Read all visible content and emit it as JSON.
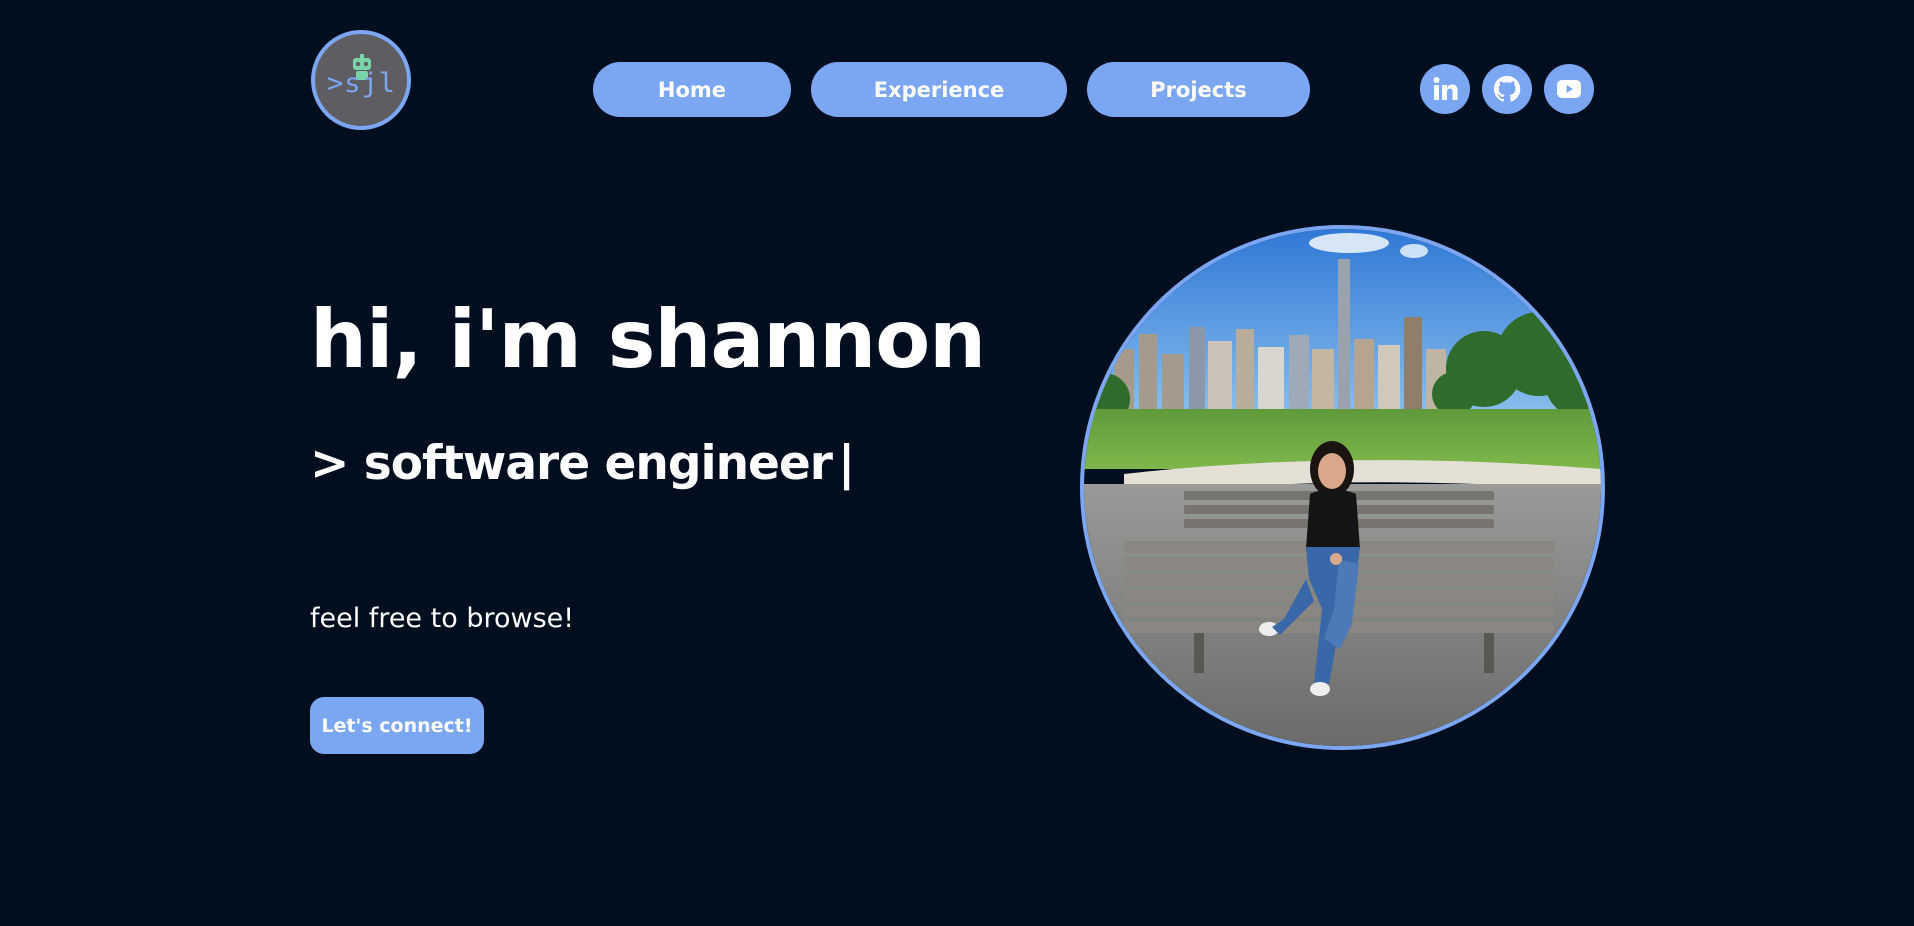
{
  "header": {
    "logo": {
      "text": ">sjl",
      "icon": "robot-icon"
    },
    "nav": [
      {
        "label": "Home"
      },
      {
        "label": "Experience"
      },
      {
        "label": "Projects"
      }
    ],
    "social": [
      {
        "icon": "linkedin-icon",
        "label": "in"
      },
      {
        "icon": "github-icon"
      },
      {
        "icon": "youtube-icon"
      }
    ]
  },
  "hero": {
    "title": "hi, i'm shannon",
    "subtitle": "> software engineer",
    "cursor": "|",
    "text": "feel free to browse!",
    "cta_label": "Let's connect!"
  },
  "portrait": {
    "description_icon": "profile-photo"
  },
  "colors": {
    "background": "#010e20",
    "accent": "#7ba7f2",
    "text": "#ffffff"
  }
}
